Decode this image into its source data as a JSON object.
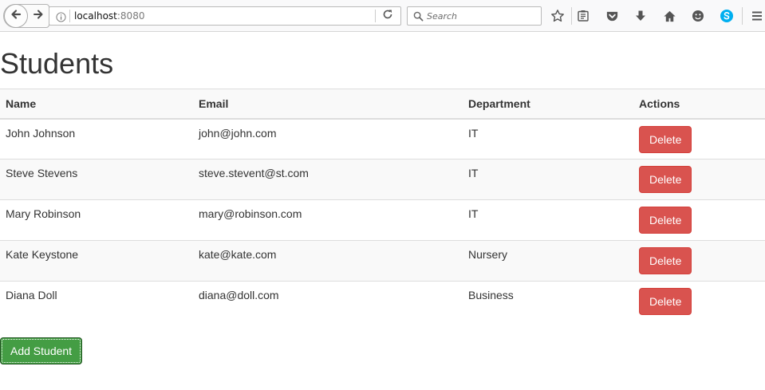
{
  "browser": {
    "url_host": "localhost",
    "url_port": ":8080",
    "search_placeholder": "Search"
  },
  "page": {
    "title": "Students"
  },
  "table": {
    "headers": {
      "name": "Name",
      "email": "Email",
      "department": "Department",
      "actions": "Actions"
    },
    "rows": [
      {
        "name": "John Johnson",
        "email": "john@john.com",
        "department": "IT",
        "action": "Delete"
      },
      {
        "name": "Steve Stevens",
        "email": "steve.stevent@st.com",
        "department": "IT",
        "action": "Delete"
      },
      {
        "name": "Mary Robinson",
        "email": "mary@robinson.com",
        "department": "IT",
        "action": "Delete"
      },
      {
        "name": "Kate Keystone",
        "email": "kate@kate.com",
        "department": "Nursery",
        "action": "Delete"
      },
      {
        "name": "Diana Doll",
        "email": "diana@doll.com",
        "department": "Business",
        "action": "Delete"
      }
    ]
  },
  "actions": {
    "add_label": "Add Student"
  },
  "colors": {
    "delete_button": "#d9534f",
    "add_button": "#449d44",
    "skype_icon": "#00aff0"
  }
}
